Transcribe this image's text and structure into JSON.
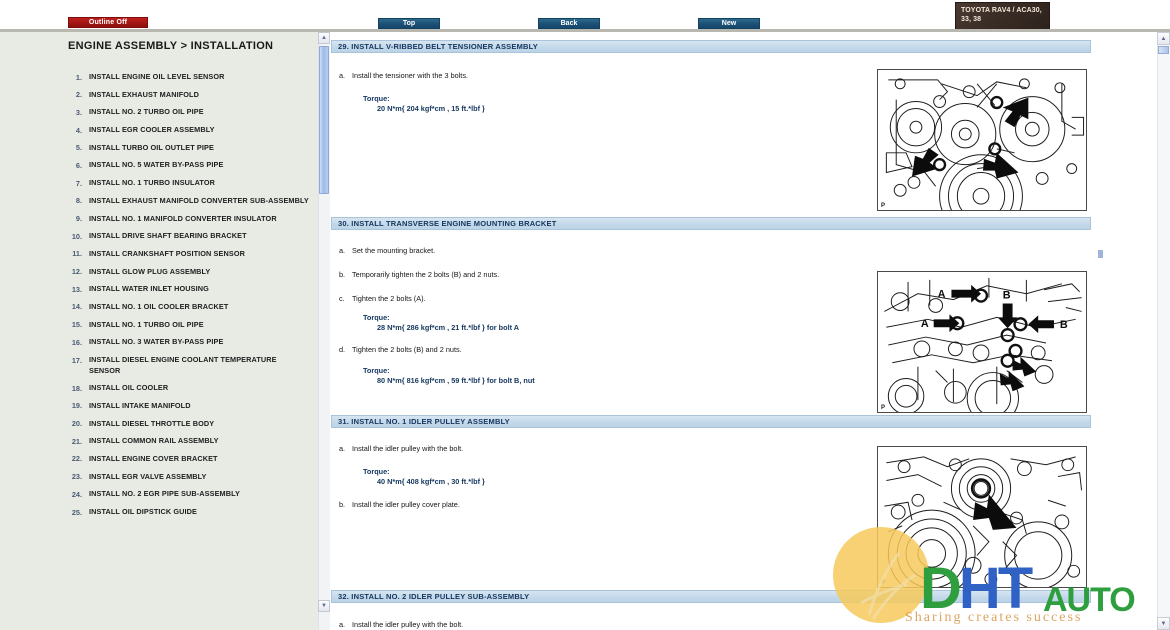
{
  "toolbar": {
    "outline_button": "Outline Off",
    "nav_top": "Top",
    "nav_back": "Back",
    "nav_new": "New",
    "vehicle_badge": "TOYOTA RAV4 / ACA30, 33, 38"
  },
  "sidebar": {
    "page_title": "ENGINE ASSEMBLY > INSTALLATION",
    "items": [
      {
        "num": "1.",
        "label": "INSTALL ENGINE OIL LEVEL SENSOR"
      },
      {
        "num": "2.",
        "label": "INSTALL EXHAUST MANIFOLD"
      },
      {
        "num": "3.",
        "label": "INSTALL NO. 2 TURBO OIL PIPE"
      },
      {
        "num": "4.",
        "label": "INSTALL EGR COOLER ASSEMBLY"
      },
      {
        "num": "5.",
        "label": "INSTALL TURBO OIL OUTLET PIPE"
      },
      {
        "num": "6.",
        "label": "INSTALL NO. 5 WATER BY-PASS PIPE"
      },
      {
        "num": "7.",
        "label": "INSTALL NO. 1 TURBO INSULATOR"
      },
      {
        "num": "8.",
        "label": "INSTALL EXHAUST MANIFOLD CONVERTER SUB-ASSEMBLY"
      },
      {
        "num": "9.",
        "label": "INSTALL NO. 1 MANIFOLD CONVERTER INSULATOR"
      },
      {
        "num": "10.",
        "label": "INSTALL DRIVE SHAFT BEARING BRACKET"
      },
      {
        "num": "11.",
        "label": "INSTALL CRANKSHAFT POSITION SENSOR"
      },
      {
        "num": "12.",
        "label": "INSTALL GLOW PLUG ASSEMBLY"
      },
      {
        "num": "13.",
        "label": "INSTALL WATER INLET HOUSING"
      },
      {
        "num": "14.",
        "label": "INSTALL NO. 1 OIL COOLER BRACKET"
      },
      {
        "num": "15.",
        "label": "INSTALL NO. 1 TURBO OIL PIPE"
      },
      {
        "num": "16.",
        "label": "INSTALL NO. 3 WATER BY-PASS PIPE"
      },
      {
        "num": "17.",
        "label": "INSTALL DIESEL ENGINE COOLANT TEMPERATURE SENSOR"
      },
      {
        "num": "18.",
        "label": "INSTALL OIL COOLER"
      },
      {
        "num": "19.",
        "label": "INSTALL INTAKE MANIFOLD"
      },
      {
        "num": "20.",
        "label": "INSTALL DIESEL THROTTLE BODY"
      },
      {
        "num": "21.",
        "label": "INSTALL COMMON RAIL ASSEMBLY"
      },
      {
        "num": "22.",
        "label": "INSTALL ENGINE COVER BRACKET"
      },
      {
        "num": "23.",
        "label": "INSTALL EGR VALVE ASSEMBLY"
      },
      {
        "num": "24.",
        "label": "INSTALL NO. 2 EGR PIPE SUB-ASSEMBLY"
      },
      {
        "num": "25.",
        "label": "INSTALL OIL DIPSTICK GUIDE"
      }
    ]
  },
  "content": {
    "sec29": {
      "heading": "29. INSTALL V-RIBBED BELT TENSIONER ASSEMBLY",
      "step_a_letter": "a.",
      "step_a": "Install the tensioner with the 3 bolts.",
      "torque_label": "Torque:",
      "torque_value": "20 N*m{ 204 kgf*cm , 15 ft.*lbf }",
      "fig_marker": "P"
    },
    "sec30": {
      "heading": "30. INSTALL TRANSVERSE ENGINE MOUNTING BRACKET",
      "step_a_letter": "a.",
      "step_a": "Set the mounting bracket.",
      "step_b_letter": "b.",
      "step_b": "Temporarily tighten the 2 bolts (B) and 2 nuts.",
      "step_c_letter": "c.",
      "step_c": "Tighten the 2 bolts (A).",
      "torque_label_1": "Torque:",
      "torque_value_1": "28 N*m{ 286 kgf*cm , 21 ft.*lbf } for bolt A",
      "step_d_letter": "d.",
      "step_d": "Tighten the 2 bolts (B) and 2 nuts.",
      "torque_label_2": "Torque:",
      "torque_value_2": "80 N*m{ 816 kgf*cm , 59 ft.*lbf } for bolt B, nut",
      "fig_marker": "P",
      "fig_label_a1": "A",
      "fig_label_a2": "A",
      "fig_label_b1": "B",
      "fig_label_b2": "B"
    },
    "sec31": {
      "heading": "31. INSTALL NO. 1 IDLER PULLEY ASSEMBLY",
      "step_a_letter": "a.",
      "step_a": "Install the idler pulley with the bolt.",
      "torque_label": "Torque:",
      "torque_value": "40 N*m{ 408 kgf*cm , 30 ft.*lbf }",
      "step_b_letter": "b.",
      "step_b": "Install the idler pulley cover plate.",
      "fig_marker": "P"
    },
    "sec32": {
      "heading": "32. INSTALL NO. 2 IDLER PULLEY SUB-ASSEMBLY",
      "step_a_letter": "a.",
      "step_a": "Install the idler pulley with the bolt."
    }
  },
  "watermark": {
    "letter_d": "D",
    "letter_h": "H",
    "letter_t": "T",
    "auto": "AUTO",
    "tagline": "Sharing creates success"
  },
  "scrollbars": {
    "up_arrow": "▲",
    "down_arrow": "▼"
  }
}
